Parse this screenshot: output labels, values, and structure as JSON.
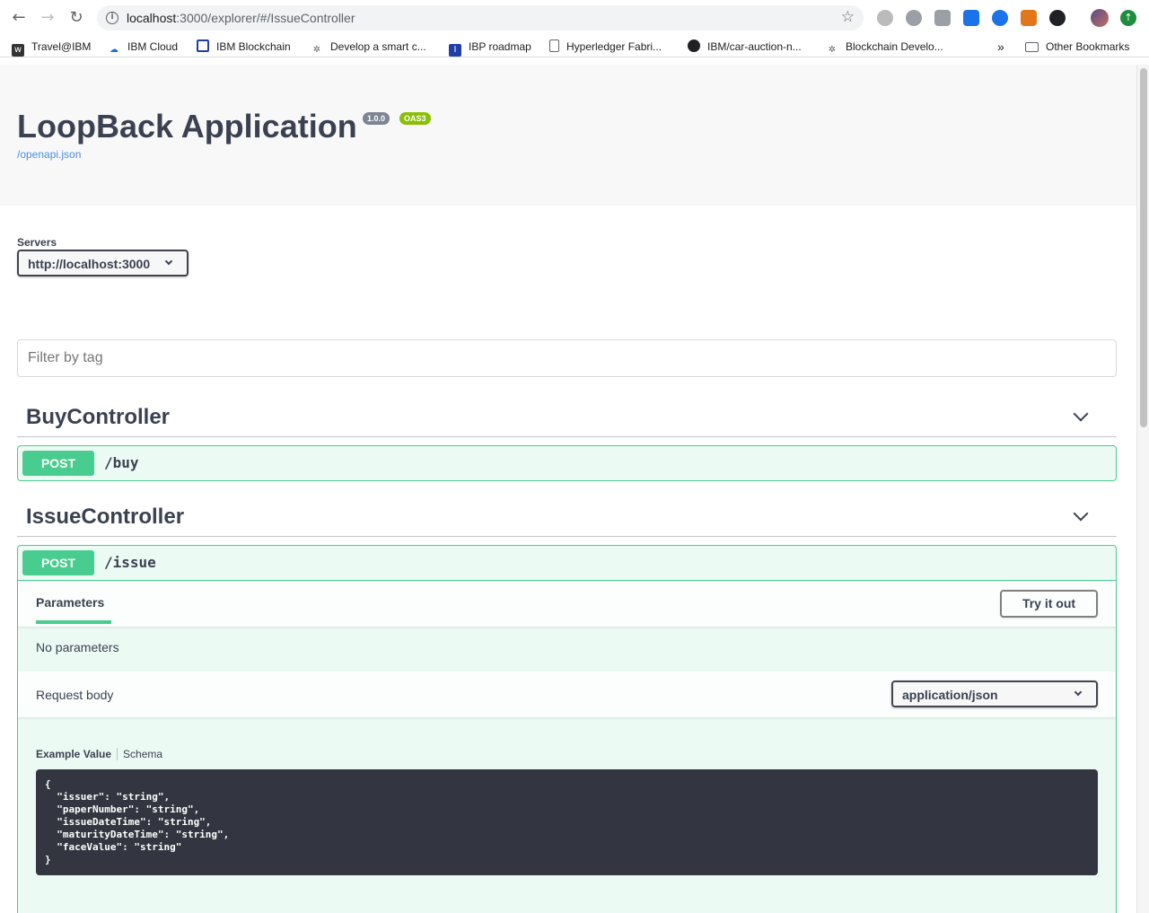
{
  "browser": {
    "url_host": "localhost",
    "url_rest": ":3000/explorer/#/IssueController",
    "bookmarks": [
      {
        "label": "Travel@IBM",
        "icon": "w3-icon"
      },
      {
        "label": "IBM Cloud",
        "icon": "cloud-icon"
      },
      {
        "label": "IBM Blockchain",
        "icon": "blockchain-icon"
      },
      {
        "label": "Develop a smart c...",
        "icon": "network-icon"
      },
      {
        "label": "IBP roadmap",
        "icon": "roadmap-icon"
      },
      {
        "label": "Hyperledger Fabri...",
        "icon": "document-icon"
      },
      {
        "label": "IBM/car-auction-n...",
        "icon": "github-icon"
      },
      {
        "label": "Blockchain Develo...",
        "icon": "network-icon"
      }
    ],
    "overflow": "»",
    "other_bookmarks": "Other Bookmarks"
  },
  "info": {
    "title": "LoopBack Application",
    "version": "1.0.0",
    "oas": "OAS3",
    "spec_link": "/openapi.json"
  },
  "servers": {
    "label": "Servers",
    "selected": "http://localhost:3000"
  },
  "filter": {
    "placeholder": "Filter by tag"
  },
  "tags": [
    {
      "name": "BuyController",
      "operations": [
        {
          "method": "POST",
          "path": "/buy"
        }
      ]
    },
    {
      "name": "IssueController",
      "operations": [
        {
          "method": "POST",
          "path": "/issue"
        }
      ]
    }
  ],
  "issue_op": {
    "parameters_tab": "Parameters",
    "try_button": "Try it out",
    "no_params": "No parameters",
    "request_body_label": "Request body",
    "content_type": "application/json",
    "example_tab": "Example Value",
    "schema_tab": "Schema",
    "example_json": "{\n  \"issuer\": \"string\",\n  \"paperNumber\": \"string\",\n  \"issueDateTime\": \"string\",\n  \"maturityDateTime\": \"string\",\n  \"faceValue\": \"string\"\n}"
  },
  "colors": {
    "post": "#49cc90",
    "text": "#3b4151",
    "link": "#4990e2"
  }
}
